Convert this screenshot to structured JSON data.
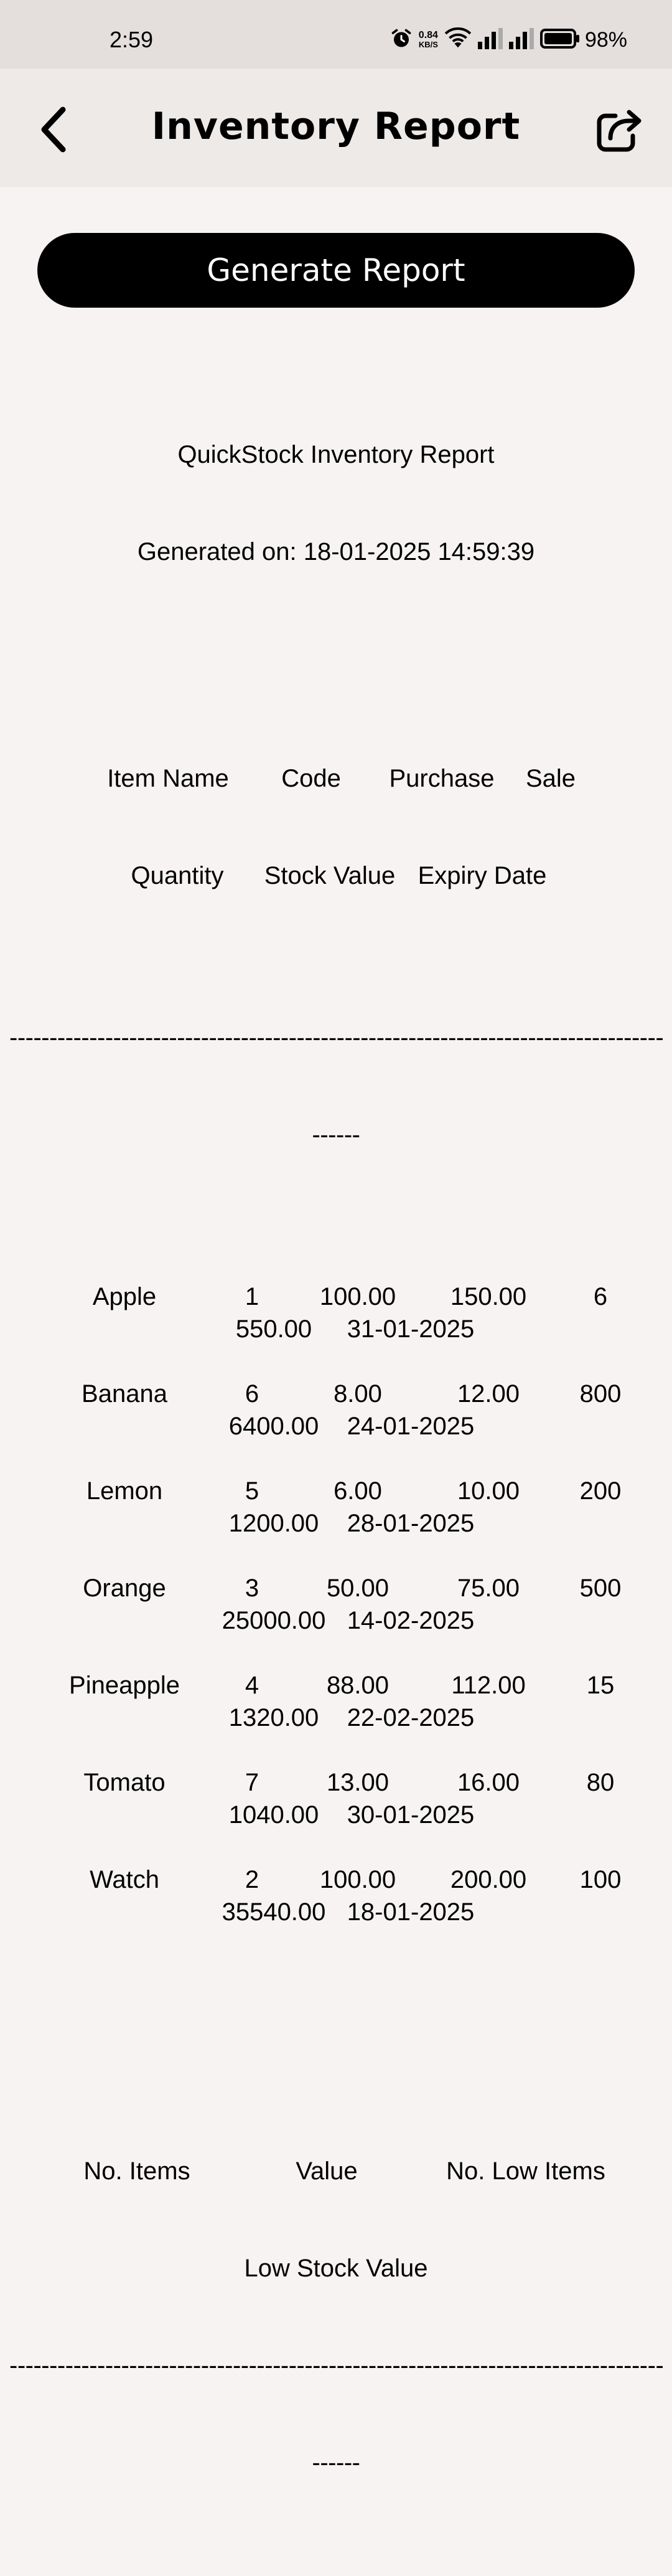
{
  "status_bar": {
    "time": "2:59",
    "net_speed_value": "0.84",
    "net_speed_unit": "KB/S",
    "battery": "98%"
  },
  "app_bar": {
    "title": "Inventory Report",
    "back_icon": "chevron-left-icon",
    "share_icon": "share-icon"
  },
  "generate_button": {
    "label": "Generate Report"
  },
  "report": {
    "title": "QuickStock Inventory Report",
    "generated_on": "Generated on: 18-01-2025 14:59:39",
    "columns_line1": [
      "Item Name",
      "Code",
      "Purchase",
      "Sale"
    ],
    "columns_line2": [
      "Quantity",
      "Stock Value",
      "Expiry Date"
    ],
    "separator": "------------------------------------------------------------------------------------------",
    "separator_tail": "------",
    "rows": [
      {
        "name": "Apple",
        "code": "1",
        "purchase": "100.00",
        "sale": "150.00",
        "quantity": "6",
        "stock_value": "550.00",
        "expiry": "31-01-2025"
      },
      {
        "name": "Banana",
        "code": "6",
        "purchase": "8.00",
        "sale": "12.00",
        "quantity": "800",
        "stock_value": "6400.00",
        "expiry": "24-01-2025"
      },
      {
        "name": "Lemon",
        "code": "5",
        "purchase": "6.00",
        "sale": "10.00",
        "quantity": "200",
        "stock_value": "1200.00",
        "expiry": "28-01-2025"
      },
      {
        "name": "Orange",
        "code": "3",
        "purchase": "50.00",
        "sale": "75.00",
        "quantity": "500",
        "stock_value": "25000.00",
        "expiry": "14-02-2025"
      },
      {
        "name": "Pineapple",
        "code": "4",
        "purchase": "88.00",
        "sale": "112.00",
        "quantity": "15",
        "stock_value": "1320.00",
        "expiry": "22-02-2025"
      },
      {
        "name": "Tomato",
        "code": "7",
        "purchase": "13.00",
        "sale": "16.00",
        "quantity": "80",
        "stock_value": "1040.00",
        "expiry": "30-01-2025"
      },
      {
        "name": "Watch",
        "code": "2",
        "purchase": "100.00",
        "sale": "200.00",
        "quantity": "100",
        "stock_value": "35540.00",
        "expiry": "18-01-2025"
      }
    ],
    "summary_line1": [
      "No. Items",
      "Value",
      "No. Low Items"
    ],
    "summary_line2": "Low Stock Value"
  }
}
